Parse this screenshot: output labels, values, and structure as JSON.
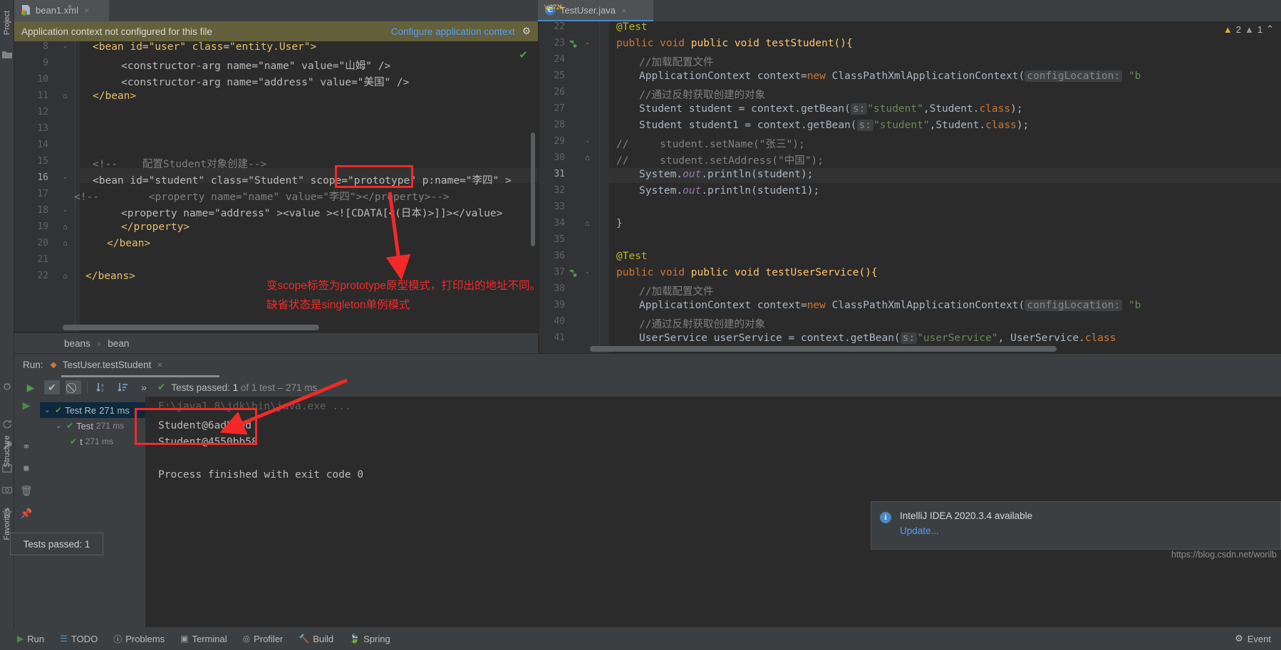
{
  "window": {
    "left_tool_labels": [
      "Project",
      "Structure",
      "Favorites"
    ]
  },
  "tabs": [
    {
      "label": "bean1.xml",
      "icon": "xml-file-icon",
      "close": "×"
    },
    {
      "label": "TestUser.java",
      "icon": "java-class-icon",
      "close": "×"
    }
  ],
  "banner": {
    "message": "Application context not configured for this file",
    "link": "Configure application context",
    "gear": "⚙"
  },
  "xml_editor": {
    "lines": [
      {
        "num": "8",
        "fold": "-",
        "current": false
      },
      {
        "num": "9",
        "fold": "",
        "current": false
      },
      {
        "num": "10",
        "fold": "",
        "current": false
      },
      {
        "num": "11",
        "fold": "⌂",
        "current": false
      },
      {
        "num": "12",
        "fold": "",
        "current": false
      },
      {
        "num": "13",
        "fold": "",
        "current": false
      },
      {
        "num": "14",
        "fold": "",
        "current": false
      },
      {
        "num": "15",
        "fold": "",
        "current": false
      },
      {
        "num": "16",
        "fold": "-",
        "current": true
      },
      {
        "num": "17",
        "fold": "",
        "current": false
      },
      {
        "num": "18",
        "fold": "-",
        "current": false
      },
      {
        "num": "19",
        "fold": "⌂",
        "current": false
      },
      {
        "num": "20",
        "fold": "⌂",
        "current": false
      },
      {
        "num": "21",
        "fold": "",
        "current": false
      },
      {
        "num": "22",
        "fold": "⌂",
        "current": false
      }
    ],
    "code": {
      "l8": "<bean id=\"user\" class=\"entity.User\">",
      "l9": "<constructor-arg name=\"name\" value=\"山姆\" />",
      "l10": "<constructor-arg name=\"address\" value=\"美国\" />",
      "l11": "</bean>",
      "l15": "<!--    配置Student对象创建-->",
      "l16": "<bean id=\"student\" class=\"Student\" scope=\"prototype\" p:name=\"李四\" >",
      "l17": "<!--        <property name=\"name\" value=\"李四\"></property>-->",
      "l18": "<property name=\"address\" ><value ><![CDATA[<(日本)>]]></value>",
      "l19": "</property>",
      "l20": "</bean>",
      "l22": "</beans>"
    },
    "breadcrumbs": [
      "beans",
      "bean"
    ],
    "inspection_ok": "✔"
  },
  "java_editor": {
    "lines": [
      {
        "num": "22",
        "run": "",
        "fold": "",
        "current": false
      },
      {
        "num": "23",
        "run": "↻",
        "fold": "-",
        "current": false
      },
      {
        "num": "24",
        "run": "",
        "fold": "",
        "current": false
      },
      {
        "num": "25",
        "run": "",
        "fold": "",
        "current": false
      },
      {
        "num": "26",
        "run": "",
        "fold": "",
        "current": false
      },
      {
        "num": "27",
        "run": "",
        "fold": "",
        "current": false
      },
      {
        "num": "28",
        "run": "",
        "fold": "",
        "current": false
      },
      {
        "num": "29",
        "run": "",
        "fold": "-",
        "current": false
      },
      {
        "num": "30",
        "run": "",
        "fold": "⌂",
        "current": false
      },
      {
        "num": "31",
        "run": "",
        "fold": "",
        "current": true
      },
      {
        "num": "32",
        "run": "",
        "fold": "",
        "current": false
      },
      {
        "num": "33",
        "run": "",
        "fold": "",
        "current": false
      },
      {
        "num": "34",
        "run": "",
        "fold": "⌂",
        "current": false
      },
      {
        "num": "35",
        "run": "",
        "fold": "",
        "current": false
      },
      {
        "num": "36",
        "run": "",
        "fold": "",
        "current": false
      },
      {
        "num": "37",
        "run": "↻",
        "fold": "-",
        "current": false
      },
      {
        "num": "38",
        "run": "",
        "fold": "",
        "current": false
      },
      {
        "num": "39",
        "run": "",
        "fold": "",
        "current": false
      },
      {
        "num": "40",
        "run": "",
        "fold": "",
        "current": false
      },
      {
        "num": "41",
        "run": "",
        "fold": "",
        "current": false
      }
    ],
    "code": {
      "l22": "@Test",
      "l23": "public void testStudent(){",
      "l24": "//加载配置文件",
      "l25_a": "ApplicationContext context=",
      "l25_new": "new",
      "l25_b": " ClassPathXmlApplicationContext(",
      "l25_hint": "configLocation:",
      "l25_c": " \"b",
      "l26": "//通过反射获取创建的对象",
      "l27_a": "Student student = context.getBean(",
      "l27_hint": "s:",
      "l27_str": "\"student\"",
      "l27_b": ",Student.",
      "l27_kw": "class",
      "l27_c": ");",
      "l28_a": "Student student1 = context.getBean(",
      "l28_hint": "s:",
      "l28_str": "\"student\"",
      "l28_b": ",Student.",
      "l28_kw": "class",
      "l28_c": ");",
      "l29": "//     student.setName(\"张三\");",
      "l30": "//     student.setAddress(\"中国\");",
      "l31_a": "System.",
      "l31_fld": "out",
      "l31_b": ".println(student);",
      "l32_a": "System.",
      "l32_fld": "out",
      "l32_b": ".println(student1);",
      "l34": "}",
      "l36": "@Test",
      "l37": "public void testUserService(){",
      "l38": "//加载配置文件",
      "l39_a": "ApplicationContext context=",
      "l39_new": "new",
      "l39_b": " ClassPathXmlApplicationContext(",
      "l39_hint": "configLocation:",
      "l39_c": " \"b",
      "l40": "//通过反射获取创建的对象",
      "l41_a": "UserService userService = context.getBean(",
      "l41_hint": "s:",
      "l41_str": "\"userService\"",
      "l41_b": ", UserService.",
      "l41_kw": "class"
    },
    "warnings": {
      "error_count": "2",
      "warn_count": "1",
      "caret": "⌃"
    },
    "settings_gear": "⚙"
  },
  "run_panel": {
    "run_label": "Run:",
    "config_name": "TestUser.testStudent",
    "close": "×",
    "toolbar_icons": [
      "rerun-play",
      "show-passed-check",
      "mute-breakpoints",
      "sort-alpha",
      "sort-duration",
      "expand-more"
    ],
    "status_check": "✔",
    "status_prefix": "Tests passed:",
    "status_count": "1",
    "status_suffix": "of 1 test – 271 ms",
    "tree": [
      {
        "indent": 0,
        "arrow": "⌄",
        "label": "Test Re",
        "time": "271 ms",
        "selected": true
      },
      {
        "indent": 1,
        "arrow": "⌄",
        "label": "Test",
        "time": "271 ms",
        "selected": false
      },
      {
        "indent": 2,
        "arrow": "",
        "label": "t",
        "time": "271 ms",
        "selected": false
      }
    ],
    "console": [
      {
        "text": "E:\\java1.8\\jdk\\bin\\java.exe ...",
        "dim": true
      },
      {
        "text": "Student@6adbc9d",
        "dim": false
      },
      {
        "text": "Student@4550bb58",
        "dim": false
      },
      {
        "text": "Process finished with exit code 0",
        "dim": false
      }
    ]
  },
  "annotations": {
    "line1": "变scope标签为prototype原型模式，打印出的地址不同。",
    "line2": "缺省状态是singleton单例模式"
  },
  "tests_passed_tooltip": "Tests passed: 1",
  "balloon": {
    "icon": "i",
    "title": "IntelliJ IDEA 2020.3.4 available",
    "link": "Update..."
  },
  "watermark": "https://blog.csdn.net/worilb",
  "statusbar": {
    "items": [
      {
        "icon": "▶",
        "label": "Run"
      },
      {
        "icon": "☰",
        "label": "TODO"
      },
      {
        "icon": "ⓘ",
        "label": "Problems"
      },
      {
        "icon": "▣",
        "label": "Terminal"
      },
      {
        "icon": "◎",
        "label": "Profiler"
      },
      {
        "icon": "🔨",
        "label": "Build"
      },
      {
        "icon": "🍃",
        "label": "Spring"
      }
    ],
    "right": {
      "icon": "⚙",
      "label": "Event"
    }
  },
  "colors": {
    "accent_blue": "#589df6",
    "annotation_red": "#f42828",
    "banner_olive": "#63603b",
    "editor_bg": "#2b2b2b",
    "chrome_bg": "#3c3f41",
    "ok_green": "#4e9a4e"
  }
}
